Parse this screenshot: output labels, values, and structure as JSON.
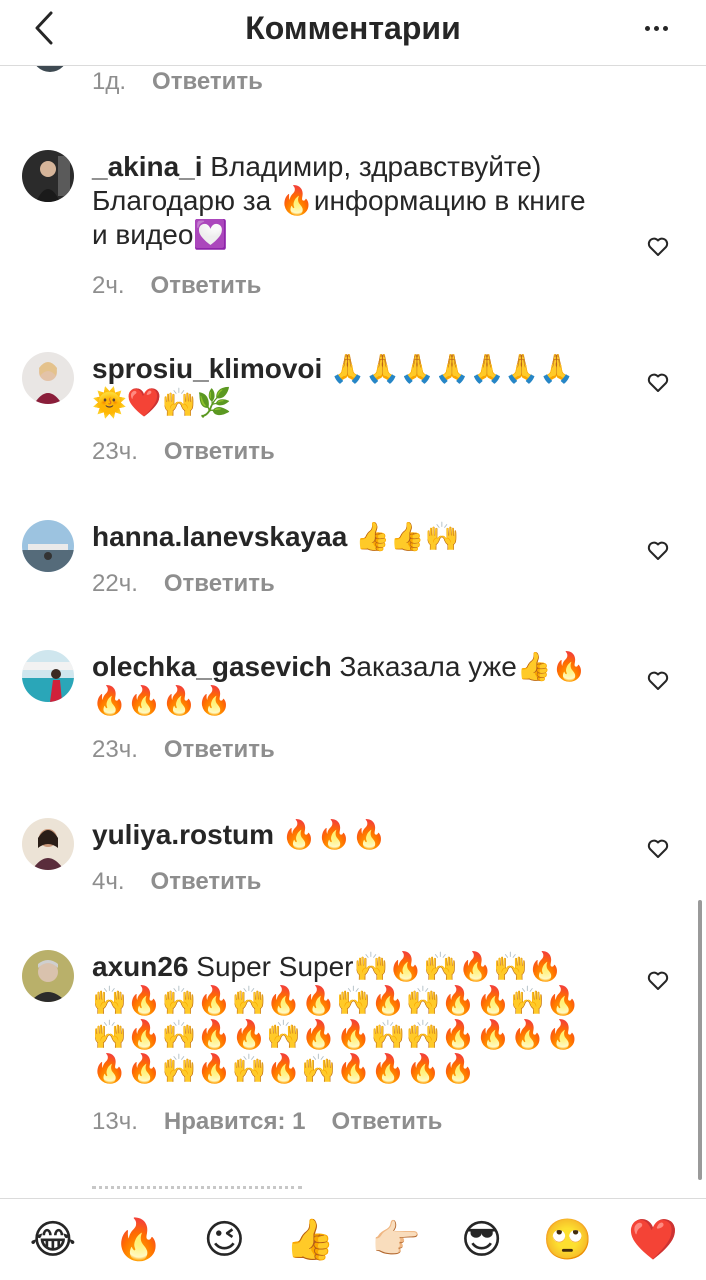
{
  "header": {
    "title": "Комментарии"
  },
  "top_meta": {
    "time": "1д.",
    "reply": "Ответить"
  },
  "comments": [
    {
      "user": "_akina_i",
      "text": " Владимир, здравствуйте) Благодарю за 🔥информацию в книге и видео💟",
      "time": "2ч.",
      "reply": "Ответить"
    },
    {
      "user": "sprosiu_klimovoi",
      "text": " 🙏🙏🙏🙏🙏🙏🙏🌞❤️🙌🌿",
      "time": "23ч.",
      "reply": "Ответить"
    },
    {
      "user": "hanna.lanevskayaa",
      "text": " 👍👍🙌",
      "time": "22ч.",
      "reply": "Ответить"
    },
    {
      "user": "olechka_gasevich",
      "text": " Заказала уже👍🔥🔥🔥🔥🔥",
      "time": "23ч.",
      "reply": "Ответить"
    },
    {
      "user": "yuliya.rostum",
      "text": " 🔥🔥🔥",
      "time": "4ч.",
      "reply": "Ответить"
    },
    {
      "user": "axun26",
      "text": " Super Super🙌🔥🙌🔥🙌🔥🙌🔥🙌🔥🙌🔥🔥🙌🔥🙌🔥🔥🙌🔥🙌🔥🙌🔥🔥🙌🔥🔥🙌🙌🔥🔥🔥🔥🔥🔥🙌🔥🙌🔥🙌🔥🔥🔥🔥",
      "time": "13ч.",
      "likes": "Нравится: 1",
      "reply": "Ответить"
    }
  ],
  "emoji_bar": [
    "😂",
    "🔥",
    "😉",
    "👍",
    "👉🏻",
    "😎",
    "🙄",
    "❤️"
  ],
  "icons": {
    "back": "chevron-left-icon",
    "more": "more-horizontal-icon",
    "like": "heart-outline-icon"
  }
}
